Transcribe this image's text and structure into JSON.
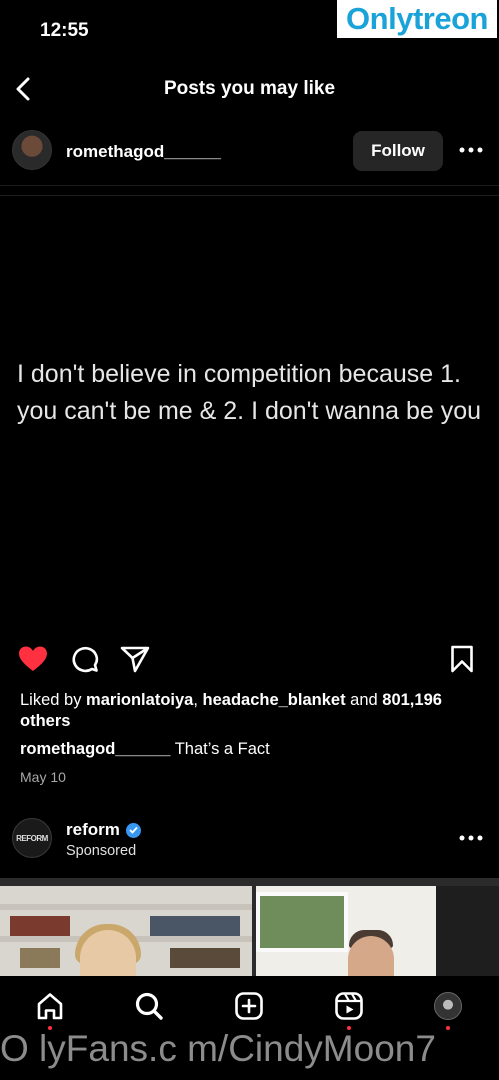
{
  "status_bar": {
    "time": "12:55"
  },
  "watermark": {
    "part1": "Only",
    "part2": "treon"
  },
  "header": {
    "title": "Posts you may like"
  },
  "post": {
    "username": "romethagod______",
    "follow_label": "Follow",
    "quote": "I don't believe in competition because 1. you can't be me & 2. I don't wanna be you",
    "liked_by_prefix": "Liked by ",
    "liked_user_1": "marionlatoiya",
    "liked_sep": ", ",
    "liked_user_2": "headache_blanket",
    "liked_and": " and ",
    "liked_others": "801,196 others",
    "caption_user": "romethagod______",
    "caption_text": " That’s a Fact",
    "date": "May 10",
    "liked": true
  },
  "ad": {
    "name": "reform",
    "sponsored": "Sponsored",
    "avatar_text": "REFORM"
  },
  "tab_bar": {
    "items": [
      "home-icon",
      "search-icon",
      "create-icon",
      "reels-icon",
      "profile-avatar"
    ]
  },
  "bottom_watermark": "O lyFans.c m/CindyMoon7",
  "colors": {
    "like_red": "#ff3040",
    "verified_blue": "#3897f0",
    "follow_bg": "#262626",
    "watermark_blue": "#1aa3d9"
  }
}
